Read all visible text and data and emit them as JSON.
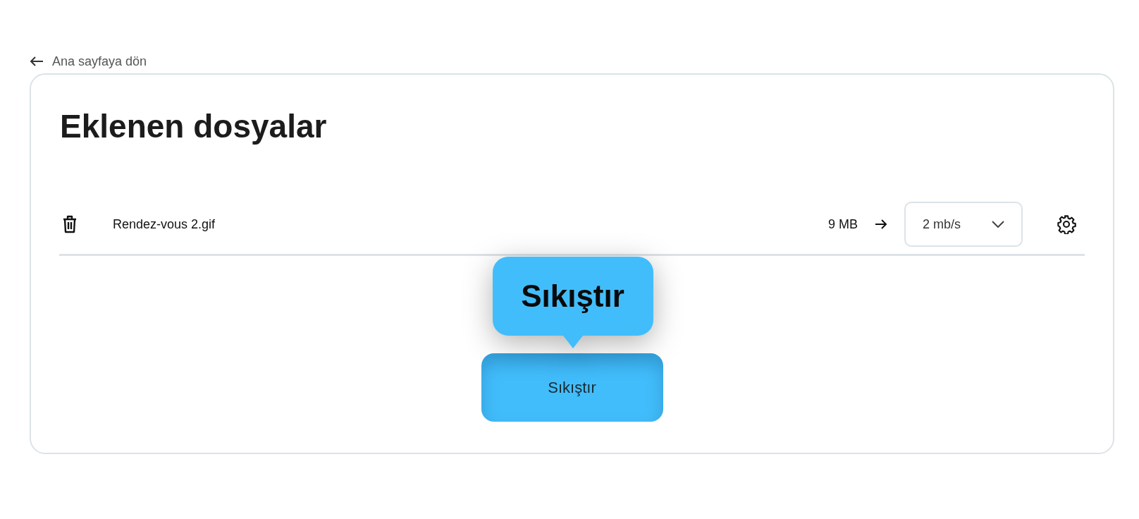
{
  "back_link": {
    "label": "Ana sayfaya dön"
  },
  "title": "Eklenen dosyalar",
  "files": [
    {
      "name": "Rendez-vous 2.gif",
      "size": "9 MB",
      "speed": "2 mb/s"
    }
  ],
  "tooltip": {
    "text": "Sıkıştır"
  },
  "compress_button": {
    "label": "Sıkıştır"
  }
}
